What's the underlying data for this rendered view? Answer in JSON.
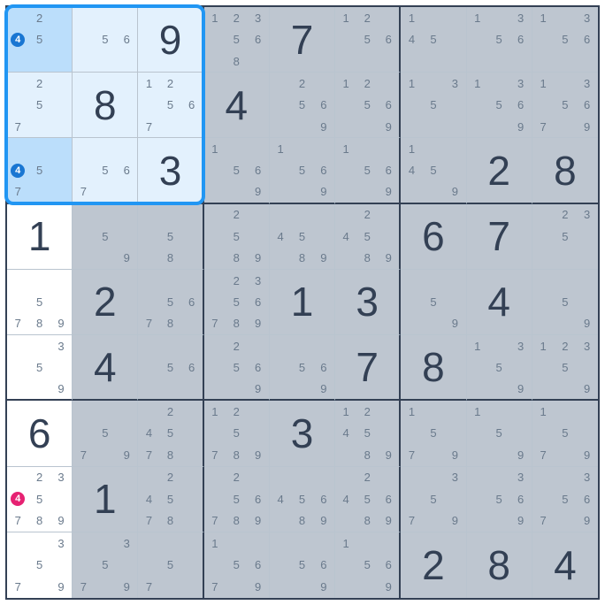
{
  "puzzle_type": "sudoku",
  "grid_size": 9,
  "highlight_box": {
    "row_start": 1,
    "col_start": 1,
    "row_end": 3,
    "col_end": 3
  },
  "marked_candidates": [
    {
      "row": 1,
      "col": 1,
      "value": 4,
      "color": "blue"
    },
    {
      "row": 3,
      "col": 1,
      "value": 4,
      "color": "blue"
    },
    {
      "row": 8,
      "col": 1,
      "value": 4,
      "color": "pink"
    }
  ],
  "cells": [
    [
      {
        "candidates": [
          2,
          4,
          5
        ],
        "hl": "mid"
      },
      {
        "candidates": [
          5,
          6
        ],
        "hl": "light"
      },
      {
        "value": 9,
        "hl": "light"
      },
      {
        "candidates": [
          1,
          2,
          3,
          5,
          6,
          8
        ],
        "shade": true
      },
      {
        "value": 7,
        "shade": true
      },
      {
        "candidates": [
          1,
          2,
          5,
          6
        ],
        "shade": true
      },
      {
        "candidates": [
          1,
          4,
          5
        ],
        "shade": true
      },
      {
        "candidates": [
          1,
          3,
          5,
          6
        ],
        "shade": true
      },
      {
        "candidates": [
          1,
          3,
          5,
          6
        ],
        "shade": true
      }
    ],
    [
      {
        "candidates": [
          2,
          5,
          7
        ],
        "hl": "light"
      },
      {
        "value": 8,
        "hl": "light"
      },
      {
        "candidates": [
          1,
          2,
          5,
          6,
          7
        ],
        "hl": "light"
      },
      {
        "value": 4,
        "shade": true
      },
      {
        "candidates": [
          2,
          5,
          6,
          9
        ],
        "shade": true
      },
      {
        "candidates": [
          1,
          2,
          5,
          6,
          9
        ],
        "shade": true
      },
      {
        "candidates": [
          1,
          3,
          5
        ],
        "shade": true
      },
      {
        "candidates": [
          1,
          3,
          5,
          6,
          9
        ],
        "shade": true
      },
      {
        "candidates": [
          1,
          3,
          5,
          6,
          7,
          9
        ],
        "shade": true
      }
    ],
    [
      {
        "candidates": [
          4,
          5,
          7
        ],
        "hl": "mid"
      },
      {
        "candidates": [
          5,
          6,
          7
        ],
        "hl": "light"
      },
      {
        "value": 3,
        "hl": "light"
      },
      {
        "candidates": [
          1,
          5,
          6,
          9
        ],
        "shade": true
      },
      {
        "candidates": [
          1,
          5,
          6,
          9
        ],
        "shade": true
      },
      {
        "candidates": [
          1,
          5,
          6,
          9
        ],
        "shade": true
      },
      {
        "candidates": [
          1,
          4,
          5,
          9
        ],
        "shade": true
      },
      {
        "value": 2,
        "shade": true
      },
      {
        "value": 8,
        "shade": true
      }
    ],
    [
      {
        "value": 1
      },
      {
        "candidates": [
          5,
          9
        ],
        "shade": true
      },
      {
        "candidates": [
          5,
          8
        ],
        "shade": true
      },
      {
        "candidates": [
          2,
          5,
          8,
          9
        ],
        "shade": true
      },
      {
        "candidates": [
          4,
          5,
          8,
          9
        ],
        "shade": true
      },
      {
        "candidates": [
          2,
          4,
          5,
          8,
          9
        ],
        "shade": true
      },
      {
        "value": 6,
        "shade": true
      },
      {
        "value": 7,
        "shade": true
      },
      {
        "candidates": [
          2,
          3,
          5
        ],
        "shade": true
      }
    ],
    [
      {
        "candidates": [
          5,
          7,
          8,
          9
        ]
      },
      {
        "value": 2,
        "shade": true
      },
      {
        "candidates": [
          5,
          6,
          7,
          8
        ],
        "shade": true
      },
      {
        "candidates": [
          2,
          3,
          5,
          6,
          7,
          8,
          9
        ],
        "shade": true
      },
      {
        "value": 1,
        "shade": true
      },
      {
        "value": 3,
        "shade": true
      },
      {
        "candidates": [
          5,
          9
        ],
        "shade": true
      },
      {
        "value": 4,
        "shade": true
      },
      {
        "candidates": [
          5,
          9
        ],
        "shade": true
      }
    ],
    [
      {
        "candidates": [
          3,
          5,
          9
        ]
      },
      {
        "value": 4,
        "shade": true
      },
      {
        "candidates": [
          5,
          6
        ],
        "shade": true
      },
      {
        "candidates": [
          2,
          5,
          6,
          9
        ],
        "shade": true
      },
      {
        "candidates": [
          5,
          6,
          9
        ],
        "shade": true
      },
      {
        "value": 7,
        "shade": true
      },
      {
        "value": 8,
        "shade": true
      },
      {
        "candidates": [
          1,
          3,
          5,
          9
        ],
        "shade": true
      },
      {
        "candidates": [
          1,
          2,
          3,
          5,
          9
        ],
        "shade": true
      }
    ],
    [
      {
        "value": 6
      },
      {
        "candidates": [
          5,
          7,
          9
        ],
        "shade": true
      },
      {
        "candidates": [
          2,
          4,
          5,
          7,
          8
        ],
        "shade": true
      },
      {
        "candidates": [
          1,
          2,
          5,
          7,
          8,
          9
        ],
        "shade": true
      },
      {
        "value": 3,
        "shade": true
      },
      {
        "candidates": [
          1,
          2,
          4,
          5,
          8,
          9
        ],
        "shade": true
      },
      {
        "candidates": [
          1,
          5,
          7,
          9
        ],
        "shade": true
      },
      {
        "candidates": [
          1,
          5,
          9
        ],
        "shade": true
      },
      {
        "candidates": [
          1,
          5,
          7,
          9
        ],
        "shade": true
      }
    ],
    [
      {
        "candidates": [
          2,
          3,
          4,
          5,
          7,
          8,
          9
        ]
      },
      {
        "value": 1,
        "shade": true
      },
      {
        "candidates": [
          2,
          4,
          5,
          7,
          8
        ],
        "shade": true
      },
      {
        "candidates": [
          2,
          5,
          6,
          7,
          8,
          9
        ],
        "shade": true
      },
      {
        "candidates": [
          4,
          5,
          6,
          8,
          9
        ],
        "shade": true
      },
      {
        "candidates": [
          2,
          4,
          5,
          6,
          8,
          9
        ],
        "shade": true
      },
      {
        "candidates": [
          3,
          5,
          7,
          9
        ],
        "shade": true
      },
      {
        "candidates": [
          3,
          5,
          6,
          9
        ],
        "shade": true
      },
      {
        "candidates": [
          3,
          5,
          6,
          7,
          9
        ],
        "shade": true
      }
    ],
    [
      {
        "candidates": [
          3,
          5,
          7,
          9
        ]
      },
      {
        "candidates": [
          3,
          5,
          7,
          9
        ],
        "shade": true
      },
      {
        "candidates": [
          5,
          7
        ],
        "shade": true
      },
      {
        "candidates": [
          1,
          5,
          6,
          7,
          9
        ],
        "shade": true
      },
      {
        "candidates": [
          5,
          6,
          9
        ],
        "shade": true
      },
      {
        "candidates": [
          1,
          5,
          6,
          9
        ],
        "shade": true
      },
      {
        "value": 2,
        "shade": true
      },
      {
        "value": 8,
        "shade": true
      },
      {
        "value": 4,
        "shade": true
      }
    ]
  ]
}
